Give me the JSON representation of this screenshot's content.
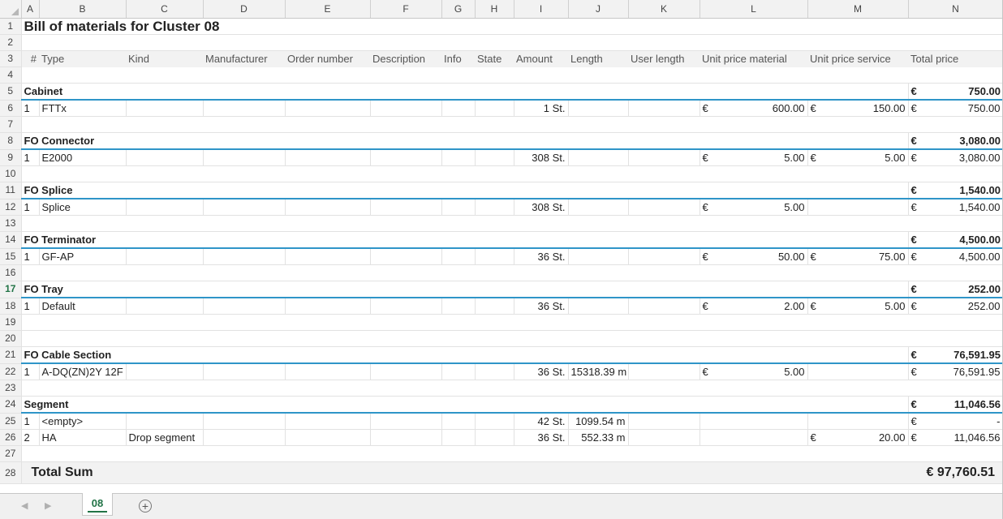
{
  "columns": [
    "A",
    "B",
    "C",
    "D",
    "E",
    "F",
    "G",
    "H",
    "I",
    "J",
    "K",
    "L",
    "M",
    "N"
  ],
  "rows": [
    {
      "n": "1",
      "type": "title",
      "text": "Bill of materials for Cluster 08"
    },
    {
      "n": "2",
      "type": "blank"
    },
    {
      "n": "3",
      "type": "hdr",
      "cells": [
        "#",
        "Type",
        "Kind",
        "Manufacturer",
        "Order number",
        "Description",
        "Info",
        "State",
        "Amount",
        "Length",
        "User length",
        "Unit price material",
        "Unit price service",
        "Total price"
      ]
    },
    {
      "n": "4",
      "type": "blank"
    },
    {
      "n": "5",
      "type": "group",
      "label": "Cabinet",
      "cur": "€",
      "total": "750.00"
    },
    {
      "n": "6",
      "type": "item",
      "num": "1",
      "name": "FTTx",
      "kind": "",
      "amount": "1 St.",
      "length": "",
      "mat_cur": "€",
      "mat": "600.00",
      "svc_cur": "€",
      "svc": "150.00",
      "tot_cur": "€",
      "tot": "750.00"
    },
    {
      "n": "7",
      "type": "blank"
    },
    {
      "n": "8",
      "type": "group",
      "label": "FO Connector",
      "cur": "€",
      "total": "3,080.00"
    },
    {
      "n": "9",
      "type": "item",
      "num": "1",
      "name": "E2000",
      "kind": "",
      "amount": "308 St.",
      "length": "",
      "mat_cur": "€",
      "mat": "5.00",
      "svc_cur": "€",
      "svc": "5.00",
      "tot_cur": "€",
      "tot": "3,080.00"
    },
    {
      "n": "10",
      "type": "blank"
    },
    {
      "n": "11",
      "type": "group",
      "label": "FO Splice",
      "cur": "€",
      "total": "1,540.00"
    },
    {
      "n": "12",
      "type": "item",
      "num": "1",
      "name": "Splice",
      "kind": "",
      "amount": "308 St.",
      "length": "",
      "mat_cur": "€",
      "mat": "5.00",
      "svc_cur": "",
      "svc": "",
      "tot_cur": "€",
      "tot": "1,540.00"
    },
    {
      "n": "13",
      "type": "blank"
    },
    {
      "n": "14",
      "type": "group",
      "label": "FO Terminator",
      "cur": "€",
      "total": "4,500.00"
    },
    {
      "n": "15",
      "type": "item",
      "num": "1",
      "name": "GF-AP",
      "kind": "",
      "amount": "36 St.",
      "length": "",
      "mat_cur": "€",
      "mat": "50.00",
      "svc_cur": "€",
      "svc": "75.00",
      "tot_cur": "€",
      "tot": "4,500.00"
    },
    {
      "n": "16",
      "type": "blank"
    },
    {
      "n": "17",
      "type": "group",
      "label": "FO Tray",
      "cur": "€",
      "total": "252.00",
      "selected": true
    },
    {
      "n": "18",
      "type": "item",
      "num": "1",
      "name": "Default",
      "kind": "",
      "amount": "36 St.",
      "length": "",
      "mat_cur": "€",
      "mat": "2.00",
      "svc_cur": "€",
      "svc": "5.00",
      "tot_cur": "€",
      "tot": "252.00"
    },
    {
      "n": "19",
      "type": "blank"
    },
    {
      "n": "20",
      "type": "blank"
    },
    {
      "n": "21",
      "type": "group",
      "label": "FO Cable Section",
      "cur": "€",
      "total": "76,591.95"
    },
    {
      "n": "22",
      "type": "item",
      "num": "1",
      "name": "A-DQ(ZN)2Y 12F",
      "kind": "",
      "amount": "36 St.",
      "length": "15318.39 m",
      "mat_cur": "€",
      "mat": "5.00",
      "svc_cur": "",
      "svc": "",
      "tot_cur": "€",
      "tot": "76,591.95"
    },
    {
      "n": "23",
      "type": "blank"
    },
    {
      "n": "24",
      "type": "group",
      "label": "Segment",
      "cur": "€",
      "total": "11,046.56"
    },
    {
      "n": "25",
      "type": "item",
      "num": "1",
      "name": "<empty>",
      "kind": "",
      "amount": "42 St.",
      "length": "1099.54 m",
      "mat_cur": "",
      "mat": "",
      "svc_cur": "",
      "svc": "",
      "tot_cur": "€",
      "tot": "-"
    },
    {
      "n": "26",
      "type": "item",
      "num": "2",
      "name": "HA",
      "kind": "Drop segment",
      "amount": "36 St.",
      "length": "552.33 m",
      "mat_cur": "",
      "mat": "",
      "svc_cur": "€",
      "svc": "20.00",
      "tot_cur": "€",
      "tot": "11,046.56"
    },
    {
      "n": "27",
      "type": "blank"
    },
    {
      "n": "28",
      "type": "total",
      "label": "Total Sum",
      "value": "€  97,760.51"
    }
  ],
  "tabs": {
    "active": "08",
    "add_icon": "plus-circle-icon",
    "prev_icon": "triangle-left-icon",
    "next_icon": "triangle-right-icon"
  },
  "colors": {
    "accent": "#217346",
    "group_line": "#2f95c8",
    "header_bg": "#f2f2f2"
  }
}
